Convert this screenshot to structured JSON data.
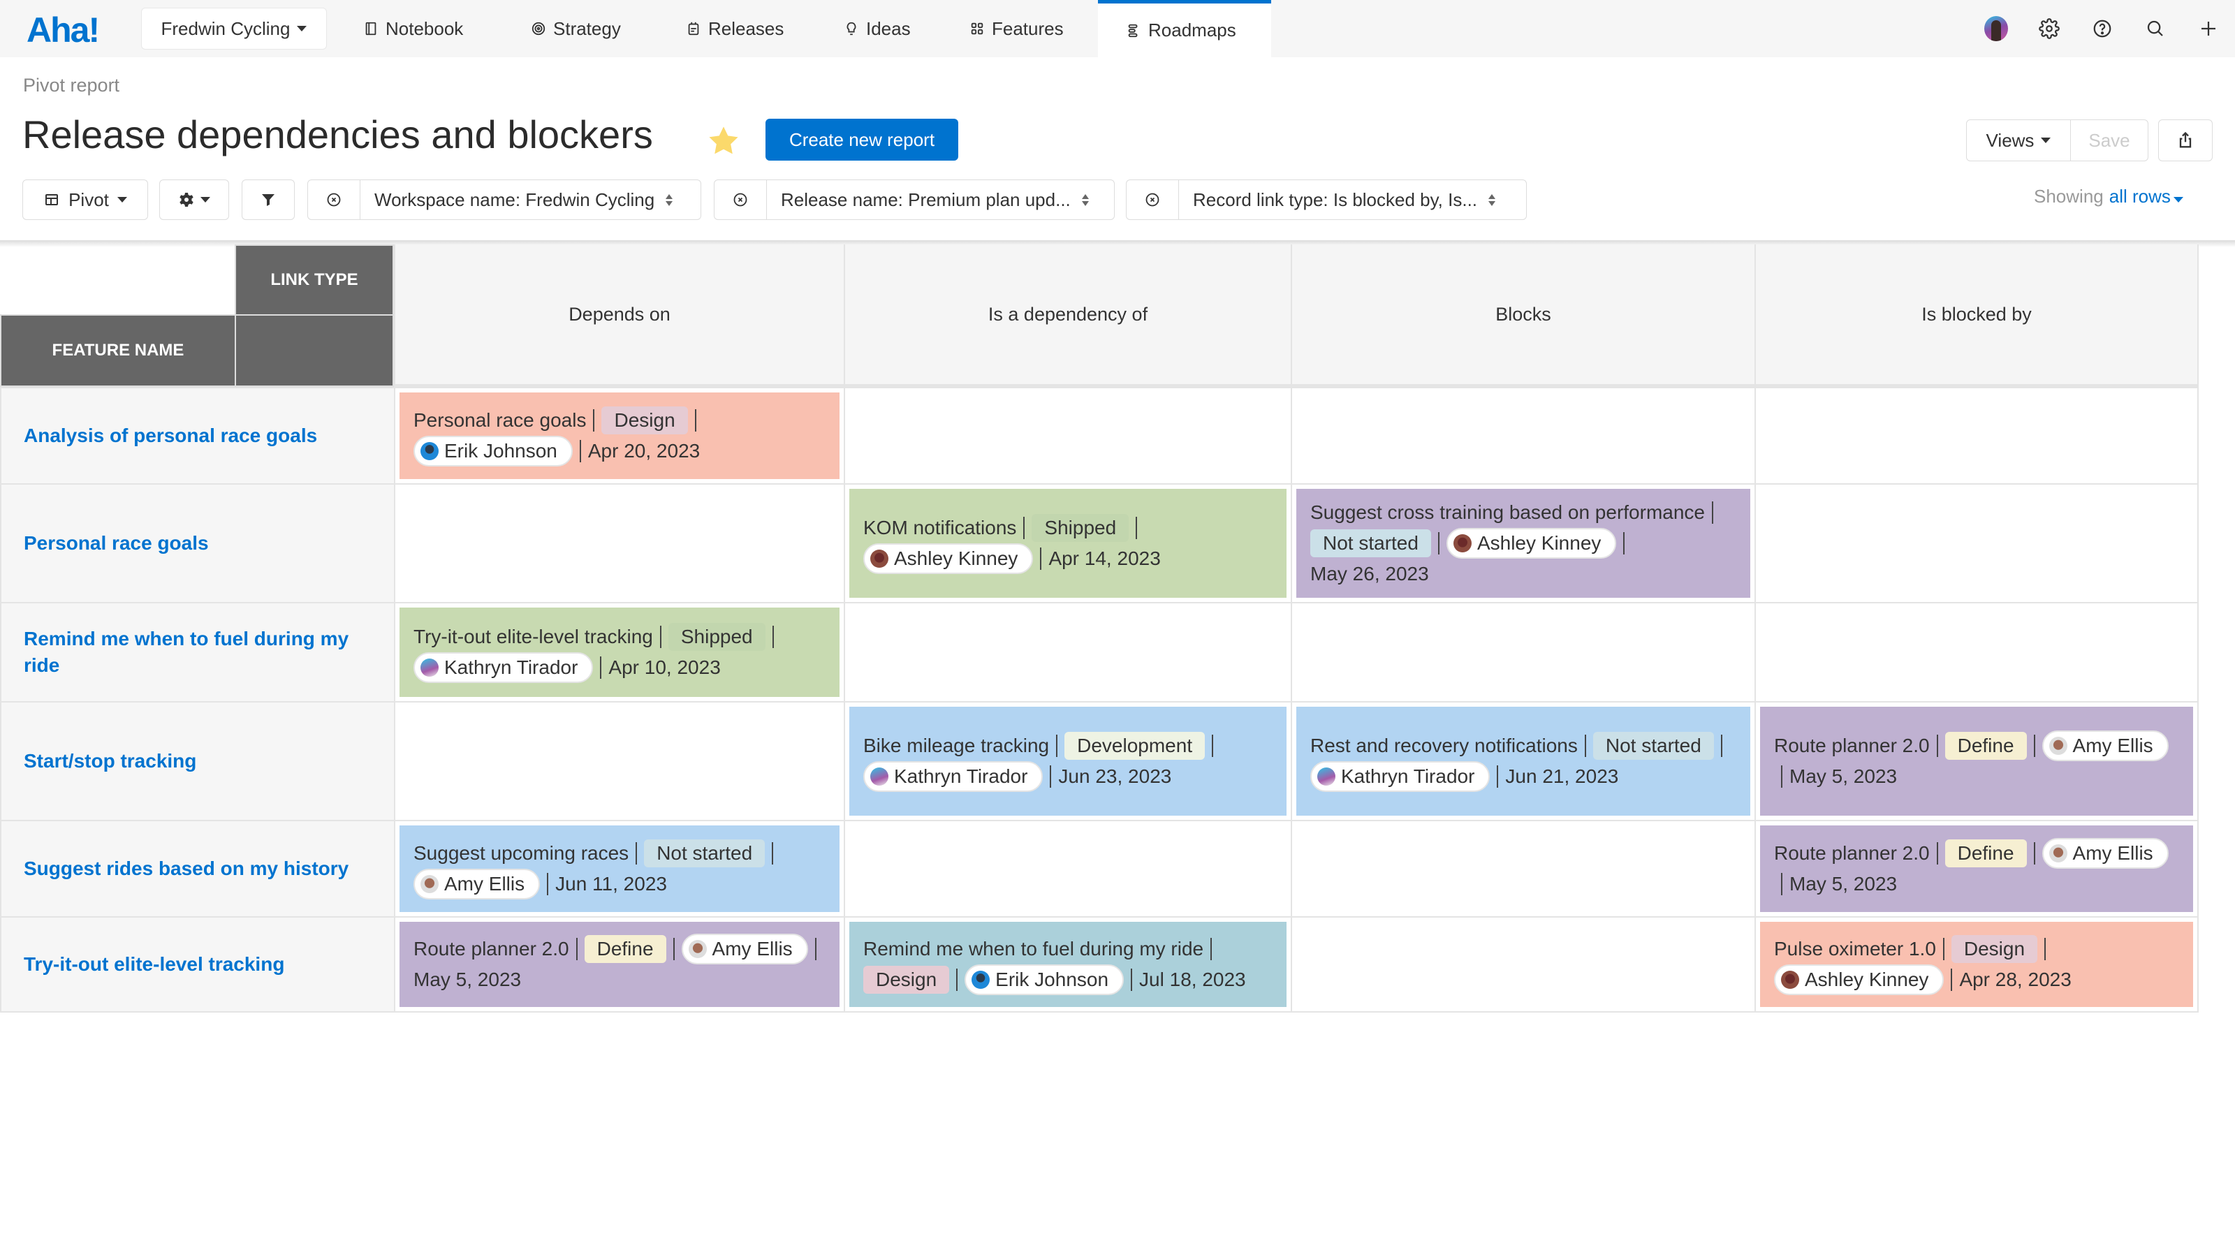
{
  "nav": {
    "logo": "Aha!",
    "workspace": "Fredwin Cycling",
    "items": [
      {
        "label": "Notebook",
        "icon": "notebook-icon"
      },
      {
        "label": "Strategy",
        "icon": "target-icon"
      },
      {
        "label": "Releases",
        "icon": "calendar-icon"
      },
      {
        "label": "Ideas",
        "icon": "lightbulb-icon"
      },
      {
        "label": "Features",
        "icon": "grid-icon"
      },
      {
        "label": "Roadmaps",
        "icon": "roadmap-icon",
        "active": true
      }
    ]
  },
  "header": {
    "breadcrumb": "Pivot report",
    "title": "Release dependencies and blockers",
    "favorite": true,
    "create_button": "Create new report",
    "views_label": "Views",
    "save_label": "Save"
  },
  "toolbar": {
    "pivot_label": "Pivot",
    "filters": [
      "Workspace name: Fredwin Cycling",
      "Release name: Premium plan upd...",
      "Record link type: Is blocked by, Is..."
    ],
    "showing_prefix": "Showing",
    "showing_value": "all rows"
  },
  "table": {
    "link_type_header": "LINK TYPE",
    "feature_name_header": "FEATURE NAME",
    "columns": [
      "Depends on",
      "Is a dependency of",
      "Blocks",
      "Is blocked by"
    ],
    "rows": [
      {
        "feature": "Analysis of personal race goals",
        "cells": [
          {
            "name": "Personal race goals",
            "status": "Design",
            "owner": "Erik Johnson",
            "date": "Apr 20, 2023",
            "color": "#f9c0b0"
          },
          null,
          null,
          null
        ]
      },
      {
        "feature": "Personal race goals",
        "cells": [
          null,
          {
            "name": "KOM notifications",
            "status": "Shipped",
            "owner": "Ashley Kinney",
            "date": "Apr 14, 2023",
            "color": "#c8dab1"
          },
          {
            "name": "Suggest cross training based on performance",
            "status": "Not started",
            "owner": "Ashley Kinney",
            "date": "May 26, 2023",
            "color": "#bfb1d1"
          },
          null
        ]
      },
      {
        "feature": "Remind me when to fuel during my ride",
        "cells": [
          {
            "name": "Try-it-out elite-level tracking",
            "status": "Shipped",
            "owner": "Kathryn Tirador",
            "date": "Apr 10, 2023",
            "color": "#c8dab1"
          },
          null,
          null,
          null
        ]
      },
      {
        "feature": "Start/stop tracking",
        "cells": [
          null,
          {
            "name": "Bike mileage tracking",
            "status": "Development",
            "owner": "Kathryn Tirador",
            "date": "Jun 23, 2023",
            "color": "#b2d4f2"
          },
          {
            "name": "Rest and recovery notifications",
            "status": "Not started",
            "owner": "Kathryn Tirador",
            "date": "Jun 21, 2023",
            "color": "#b2d4f2"
          },
          {
            "name": "Route planner 2.0",
            "status": "Define",
            "owner": "Amy Ellis",
            "date": "May 5, 2023",
            "color": "#bfb1d1"
          }
        ]
      },
      {
        "feature": "Suggest rides based on my history",
        "cells": [
          {
            "name": "Suggest upcoming races",
            "status": "Not started",
            "owner": "Amy Ellis",
            "date": "Jun 11, 2023",
            "color": "#b2d4f2"
          },
          null,
          null,
          {
            "name": "Route planner 2.0",
            "status": "Define",
            "owner": "Amy Ellis",
            "date": "May 5, 2023",
            "color": "#bfb1d1"
          }
        ]
      },
      {
        "feature": "Try-it-out elite-level tracking",
        "cells": [
          {
            "name": "Route planner 2.0",
            "status": "Define",
            "owner": "Amy Ellis",
            "date": "May 5, 2023",
            "color": "#bfb1d1"
          },
          {
            "name": "Remind me when to fuel during my ride",
            "status": "Design",
            "owner": "Erik Johnson",
            "date": "Jul 18, 2023",
            "color": "#abd0da"
          },
          null,
          {
            "name": "Pulse oximeter 1.0",
            "status": "Design",
            "owner": "Ashley Kinney",
            "date": "Apr 28, 2023",
            "color": "#f9c0b0"
          }
        ]
      }
    ],
    "status_colors": {
      "Design": "#e6cbd3",
      "Shipped": "#c2d6ae",
      "Not started": "#cbe0e8",
      "Development": "#eef3e4",
      "Define": "#f6efd2"
    }
  }
}
